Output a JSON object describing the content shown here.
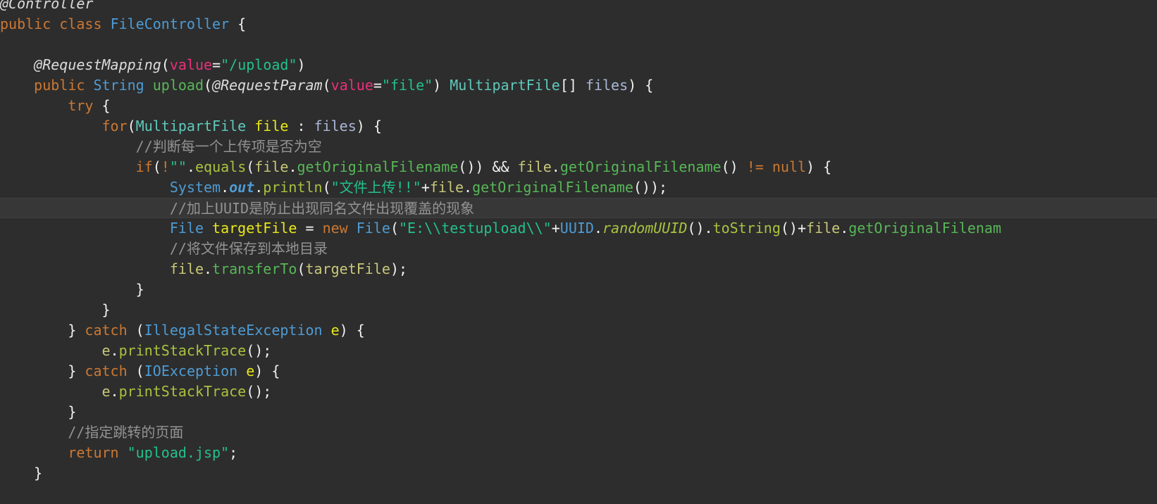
{
  "editor": {
    "language": "java",
    "theme": "darcula",
    "background_color": "#2d2d2d",
    "current_line_highlight_color": "#373737",
    "current_line_index": 9,
    "colors": {
      "keyword": "#cc7832",
      "class_name": "#4e9bd4",
      "interface_name": "#5fc9bb",
      "string": "#23c18a",
      "comment": "#939393",
      "method_call": "#57b757",
      "static_method": "#a9c23f",
      "field": "#c8c87a",
      "local_var": "#a9b7d6",
      "identifier_highlight": "#e8e817",
      "annotation_param": "#e8307a",
      "annotation": "#dcdcdc",
      "plain": "#f8f8f2"
    }
  },
  "code": {
    "lines": [
      {
        "id": "line-annotation-controller",
        "tokens": [
          {
            "text": "@Controller",
            "cls": "t-annoname"
          }
        ]
      },
      {
        "id": "line-class-declaration",
        "tokens": [
          {
            "text": "public",
            "cls": "t-kw"
          },
          {
            "text": " ",
            "cls": "t-plain"
          },
          {
            "text": "class",
            "cls": "t-kw"
          },
          {
            "text": " ",
            "cls": "t-plain"
          },
          {
            "text": "FileController",
            "cls": "t-type"
          },
          {
            "text": " {",
            "cls": "t-punc"
          }
        ]
      },
      {
        "id": "line-blank-1",
        "tokens": [
          {
            "text": "",
            "cls": "t-plain"
          }
        ]
      },
      {
        "id": "line-request-mapping",
        "tokens": [
          {
            "text": "    ",
            "cls": "t-plain"
          },
          {
            "text": "@RequestMapping",
            "cls": "t-annoname"
          },
          {
            "text": "(",
            "cls": "t-punc"
          },
          {
            "text": "value",
            "cls": "t-param"
          },
          {
            "text": "=",
            "cls": "t-punc"
          },
          {
            "text": "\"/upload\"",
            "cls": "t-str"
          },
          {
            "text": ")",
            "cls": "t-punc"
          }
        ]
      },
      {
        "id": "line-method-upload",
        "tokens": [
          {
            "text": "    ",
            "cls": "t-plain"
          },
          {
            "text": "public",
            "cls": "t-kw"
          },
          {
            "text": " ",
            "cls": "t-plain"
          },
          {
            "text": "String",
            "cls": "t-type"
          },
          {
            "text": " ",
            "cls": "t-plain"
          },
          {
            "text": "upload",
            "cls": "t-method"
          },
          {
            "text": "(",
            "cls": "t-punc"
          },
          {
            "text": "@RequestParam",
            "cls": "t-annoname"
          },
          {
            "text": "(",
            "cls": "t-punc"
          },
          {
            "text": "value",
            "cls": "t-param"
          },
          {
            "text": "=",
            "cls": "t-punc"
          },
          {
            "text": "\"file\"",
            "cls": "t-str"
          },
          {
            "text": ") ",
            "cls": "t-punc"
          },
          {
            "text": "MultipartFile",
            "cls": "t-type2"
          },
          {
            "text": "[] ",
            "cls": "t-punc"
          },
          {
            "text": "files",
            "cls": "t-var"
          },
          {
            "text": ") {",
            "cls": "t-punc"
          }
        ]
      },
      {
        "id": "line-try",
        "tokens": [
          {
            "text": "        ",
            "cls": "t-plain"
          },
          {
            "text": "try",
            "cls": "t-kw"
          },
          {
            "text": " {",
            "cls": "t-punc"
          }
        ]
      },
      {
        "id": "line-for-loop",
        "tokens": [
          {
            "text": "            ",
            "cls": "t-plain"
          },
          {
            "text": "for",
            "cls": "t-kw"
          },
          {
            "text": "(",
            "cls": "t-punc"
          },
          {
            "text": "MultipartFile",
            "cls": "t-type2"
          },
          {
            "text": " ",
            "cls": "t-plain"
          },
          {
            "text": "file",
            "cls": "t-hl"
          },
          {
            "text": " : ",
            "cls": "t-punc"
          },
          {
            "text": "files",
            "cls": "t-var"
          },
          {
            "text": ") {",
            "cls": "t-punc"
          }
        ]
      },
      {
        "id": "line-comment-check-empty",
        "tokens": [
          {
            "text": "                ",
            "cls": "t-plain"
          },
          {
            "text": "//判断每一个上传项是否为空",
            "cls": "t-cmt"
          }
        ]
      },
      {
        "id": "line-if-filename-check",
        "tokens": [
          {
            "text": "                ",
            "cls": "t-plain"
          },
          {
            "text": "if",
            "cls": "t-kw"
          },
          {
            "text": "(",
            "cls": "t-punc"
          },
          {
            "text": "!",
            "cls": "t-kw"
          },
          {
            "text": "\"\"",
            "cls": "t-str"
          },
          {
            "text": ".",
            "cls": "t-punc"
          },
          {
            "text": "equals",
            "cls": "t-static"
          },
          {
            "text": "(",
            "cls": "t-punc"
          },
          {
            "text": "file",
            "cls": "t-field"
          },
          {
            "text": ".",
            "cls": "t-punc"
          },
          {
            "text": "getOriginalFilename",
            "cls": "t-method"
          },
          {
            "text": "()) ",
            "cls": "t-punc"
          },
          {
            "text": "&&",
            "cls": "t-punc"
          },
          {
            "text": " ",
            "cls": "t-plain"
          },
          {
            "text": "file",
            "cls": "t-field"
          },
          {
            "text": ".",
            "cls": "t-punc"
          },
          {
            "text": "getOriginalFilename",
            "cls": "t-method"
          },
          {
            "text": "() ",
            "cls": "t-punc"
          },
          {
            "text": "!=",
            "cls": "t-kw"
          },
          {
            "text": " ",
            "cls": "t-plain"
          },
          {
            "text": "null",
            "cls": "t-kw"
          },
          {
            "text": ") {",
            "cls": "t-punc"
          }
        ]
      },
      {
        "id": "line-println-upload",
        "tokens": [
          {
            "text": "                    ",
            "cls": "t-plain"
          },
          {
            "text": "System",
            "cls": "t-sysblue"
          },
          {
            "text": ".",
            "cls": "t-punc"
          },
          {
            "text": "out",
            "cls": "t-sysit"
          },
          {
            "text": ".",
            "cls": "t-punc"
          },
          {
            "text": "println",
            "cls": "t-static"
          },
          {
            "text": "(",
            "cls": "t-punc"
          },
          {
            "text": "\"文件上传!!\"",
            "cls": "t-str"
          },
          {
            "text": "+",
            "cls": "t-punc"
          },
          {
            "text": "file",
            "cls": "t-field"
          },
          {
            "text": ".",
            "cls": "t-punc"
          },
          {
            "text": "getOriginalFilename",
            "cls": "t-method"
          },
          {
            "text": "());",
            "cls": "t-punc"
          }
        ]
      },
      {
        "id": "line-comment-uuid",
        "current": true,
        "tokens": [
          {
            "text": "                    ",
            "cls": "t-plain"
          },
          {
            "text": "//加上UUID是防止出现同名文件出现覆盖的现象",
            "cls": "t-cmt"
          }
        ]
      },
      {
        "id": "line-target-file",
        "tokens": [
          {
            "text": "                    ",
            "cls": "t-plain"
          },
          {
            "text": "File",
            "cls": "t-type"
          },
          {
            "text": " ",
            "cls": "t-plain"
          },
          {
            "text": "targetFile",
            "cls": "t-hly"
          },
          {
            "text": " = ",
            "cls": "t-punc"
          },
          {
            "text": "new",
            "cls": "t-kw"
          },
          {
            "text": " ",
            "cls": "t-plain"
          },
          {
            "text": "File",
            "cls": "t-type"
          },
          {
            "text": "(",
            "cls": "t-punc"
          },
          {
            "text": "\"E:\\\\testupload\\\\\"",
            "cls": "t-str"
          },
          {
            "text": "+",
            "cls": "t-punc"
          },
          {
            "text": "UUID",
            "cls": "t-type"
          },
          {
            "text": ".",
            "cls": "t-punc"
          },
          {
            "text": "randomUUID",
            "cls": "t-staticit"
          },
          {
            "text": "()",
            "cls": "t-punc"
          },
          {
            "text": ".",
            "cls": "t-punc"
          },
          {
            "text": "toString",
            "cls": "t-static"
          },
          {
            "text": "()",
            "cls": "t-punc"
          },
          {
            "text": "+",
            "cls": "t-punc"
          },
          {
            "text": "file",
            "cls": "t-field"
          },
          {
            "text": ".",
            "cls": "t-punc"
          },
          {
            "text": "getOriginalFilenam",
            "cls": "t-method"
          }
        ]
      },
      {
        "id": "line-comment-save-local",
        "tokens": [
          {
            "text": "                    ",
            "cls": "t-plain"
          },
          {
            "text": "//将文件保存到本地目录",
            "cls": "t-cmt"
          }
        ]
      },
      {
        "id": "line-transfer-to",
        "tokens": [
          {
            "text": "                    ",
            "cls": "t-plain"
          },
          {
            "text": "file",
            "cls": "t-field"
          },
          {
            "text": ".",
            "cls": "t-punc"
          },
          {
            "text": "transferTo",
            "cls": "t-method"
          },
          {
            "text": "(",
            "cls": "t-punc"
          },
          {
            "text": "targetFile",
            "cls": "t-field"
          },
          {
            "text": ");",
            "cls": "t-punc"
          }
        ]
      },
      {
        "id": "line-close-if",
        "tokens": [
          {
            "text": "                ",
            "cls": "t-plain"
          },
          {
            "text": "}",
            "cls": "t-punc"
          }
        ]
      },
      {
        "id": "line-close-for",
        "tokens": [
          {
            "text": "            ",
            "cls": "t-plain"
          },
          {
            "text": "}",
            "cls": "t-punc"
          }
        ]
      },
      {
        "id": "line-catch-illegal-state",
        "tokens": [
          {
            "text": "        ",
            "cls": "t-plain"
          },
          {
            "text": "} ",
            "cls": "t-punc"
          },
          {
            "text": "catch",
            "cls": "t-kw"
          },
          {
            "text": " (",
            "cls": "t-punc"
          },
          {
            "text": "IllegalStateException",
            "cls": "t-type"
          },
          {
            "text": " ",
            "cls": "t-plain"
          },
          {
            "text": "e",
            "cls": "t-hl"
          },
          {
            "text": ") {",
            "cls": "t-punc"
          }
        ]
      },
      {
        "id": "line-print-stack-1",
        "tokens": [
          {
            "text": "            ",
            "cls": "t-plain"
          },
          {
            "text": "e",
            "cls": "t-field"
          },
          {
            "text": ".",
            "cls": "t-punc"
          },
          {
            "text": "printStackTrace",
            "cls": "t-static"
          },
          {
            "text": "();",
            "cls": "t-punc"
          }
        ]
      },
      {
        "id": "line-catch-io",
        "tokens": [
          {
            "text": "        ",
            "cls": "t-plain"
          },
          {
            "text": "} ",
            "cls": "t-punc"
          },
          {
            "text": "catch",
            "cls": "t-kw"
          },
          {
            "text": " (",
            "cls": "t-punc"
          },
          {
            "text": "IOException",
            "cls": "t-type"
          },
          {
            "text": " ",
            "cls": "t-plain"
          },
          {
            "text": "e",
            "cls": "t-hl"
          },
          {
            "text": ") {",
            "cls": "t-punc"
          }
        ]
      },
      {
        "id": "line-print-stack-2",
        "tokens": [
          {
            "text": "            ",
            "cls": "t-plain"
          },
          {
            "text": "e",
            "cls": "t-field"
          },
          {
            "text": ".",
            "cls": "t-punc"
          },
          {
            "text": "printStackTrace",
            "cls": "t-static"
          },
          {
            "text": "();",
            "cls": "t-punc"
          }
        ]
      },
      {
        "id": "line-close-catch",
        "tokens": [
          {
            "text": "        ",
            "cls": "t-plain"
          },
          {
            "text": "}",
            "cls": "t-punc"
          }
        ]
      },
      {
        "id": "line-comment-redirect",
        "tokens": [
          {
            "text": "        ",
            "cls": "t-plain"
          },
          {
            "text": "//指定跳转的页面",
            "cls": "t-cmt"
          }
        ]
      },
      {
        "id": "line-return",
        "tokens": [
          {
            "text": "        ",
            "cls": "t-plain"
          },
          {
            "text": "return",
            "cls": "t-kw"
          },
          {
            "text": " ",
            "cls": "t-plain"
          },
          {
            "text": "\"upload.jsp\"",
            "cls": "t-str"
          },
          {
            "text": ";",
            "cls": "t-punc"
          }
        ]
      },
      {
        "id": "line-close-method",
        "tokens": [
          {
            "text": "    ",
            "cls": "t-plain"
          },
          {
            "text": "}",
            "cls": "t-punc"
          }
        ]
      }
    ]
  }
}
